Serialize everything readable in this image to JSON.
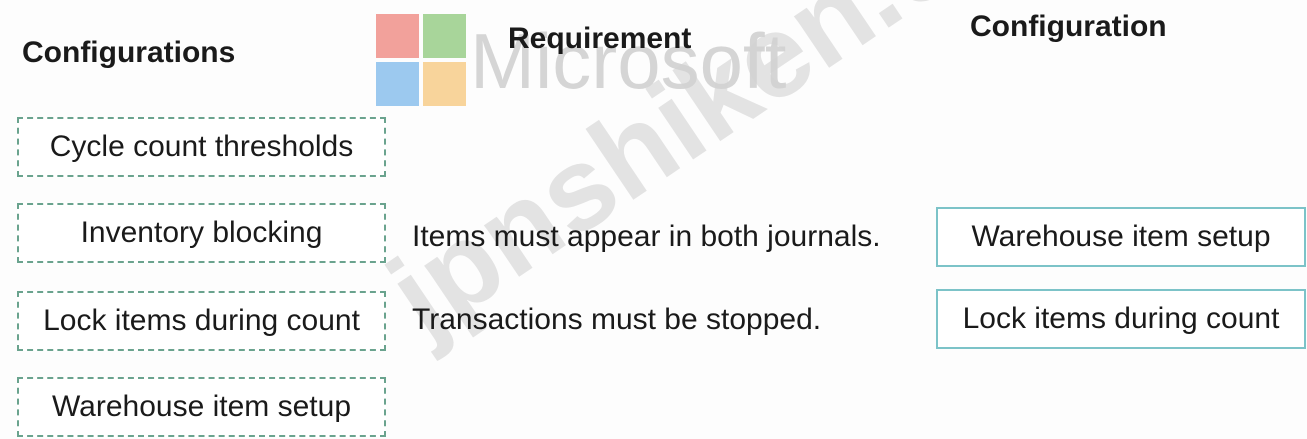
{
  "headings": {
    "configurations": "Configurations",
    "requirement": "Requirement",
    "configuration": "Configuration"
  },
  "watermark": {
    "logo_text": "Microsoft",
    "site_text": "jpnshiken.com"
  },
  "options": [
    "Cycle count thresholds",
    "Inventory blocking",
    "Lock items during count",
    "Warehouse item setup"
  ],
  "rows": [
    {
      "requirement": "Items must appear in both journals.",
      "answer": "Warehouse item setup"
    },
    {
      "requirement": "Transactions must be stopped.",
      "answer": "Lock items during count"
    }
  ],
  "colors": {
    "dashed_border": "#6aa38e",
    "answer_border": "#7cc3c8",
    "logo_red": "#f2a19b",
    "logo_green": "#a8d59a",
    "logo_blue": "#9cc9ef",
    "logo_yellow": "#f8d49b"
  }
}
